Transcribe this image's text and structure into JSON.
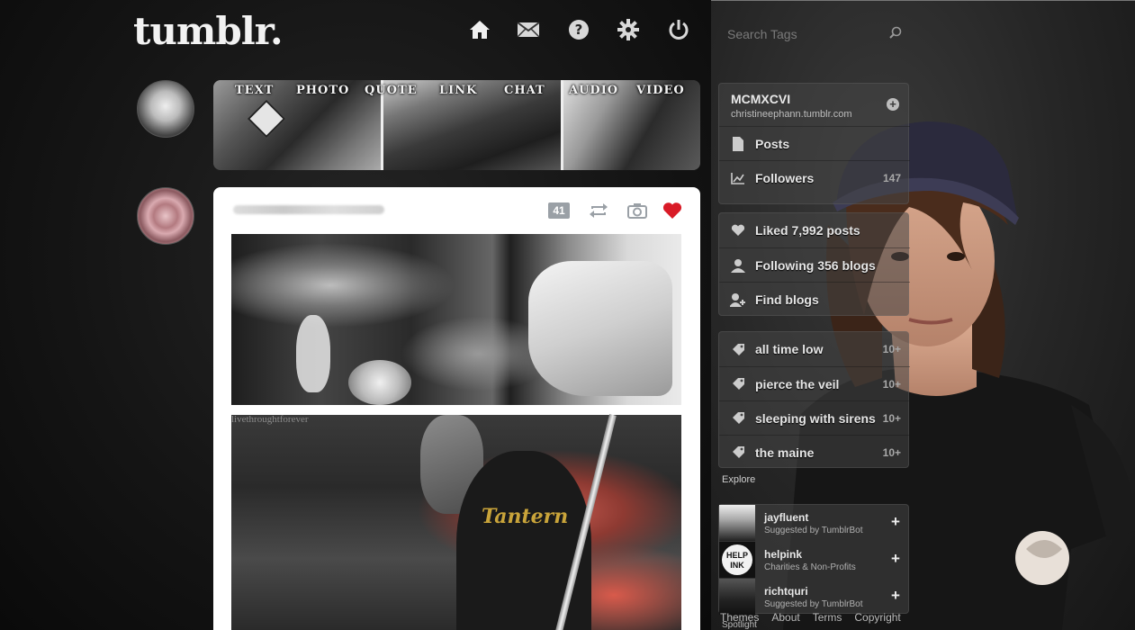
{
  "header": {
    "logo": "tumblr.",
    "nav": [
      {
        "name": "home-icon"
      },
      {
        "name": "mail-icon"
      },
      {
        "name": "help-icon"
      },
      {
        "name": "gear-icon"
      },
      {
        "name": "power-icon"
      }
    ],
    "search_placeholder": "Search Tags"
  },
  "post_types": [
    "TEXT",
    "PHOTO",
    "QUOTE",
    "LINK",
    "CHAT",
    "AUDIO",
    "VIDEO"
  ],
  "post": {
    "notes_count": "41",
    "photo_credit": "livethroughtforever",
    "shirt_text": "Tantern"
  },
  "sidebar": {
    "blog_name": "MCMXCVI",
    "blog_url": "christineephann.tumblr.com",
    "items": [
      {
        "label": "Posts",
        "count": ""
      },
      {
        "label": "Followers",
        "count": "147"
      }
    ],
    "links": [
      {
        "label": "Liked 7,992 posts"
      },
      {
        "label": "Following 356 blogs"
      },
      {
        "label": "Find blogs"
      }
    ],
    "tags": [
      {
        "label": "all time low",
        "count": "10+"
      },
      {
        "label": "pierce the veil",
        "count": "10+"
      },
      {
        "label": "sleeping with sirens",
        "count": "10+"
      },
      {
        "label": "the maine",
        "count": "10+"
      }
    ],
    "explore_label": "Explore",
    "suggestions": [
      {
        "name": "jayfluent",
        "sub": "Suggested by TumblrBot"
      },
      {
        "name": "helpink",
        "sub": "Charities & Non-Profits"
      },
      {
        "name": "richtquri",
        "sub": "Suggested by TumblrBot"
      }
    ],
    "help_ink_badge": "HELP INK"
  },
  "footer": [
    "Themes",
    "About",
    "Terms",
    "Copyright"
  ],
  "footer2": "Spotlight",
  "colors": {
    "heart": "#d91b27",
    "badge": "#9aa0a6"
  }
}
